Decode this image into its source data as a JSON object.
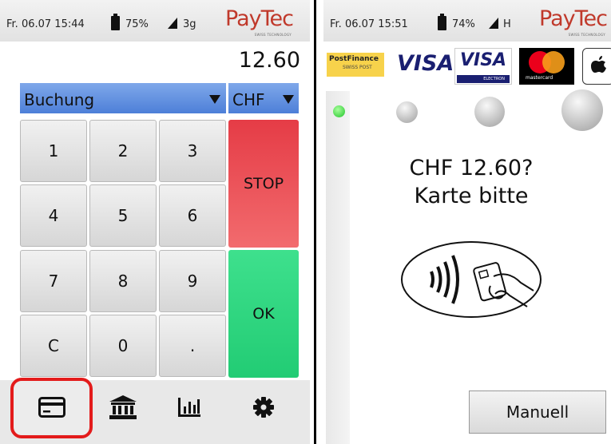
{
  "left": {
    "status": {
      "datetime": "Fr. 06.07 15:44",
      "battery": "75%",
      "network": "3g"
    },
    "brand": {
      "logo": "PayTec",
      "tagline": "SWISS TECHNOLOGY"
    },
    "amount": "12.60",
    "mode_select": {
      "value": "Buchung"
    },
    "currency_select": {
      "value": "CHF"
    },
    "keypad": {
      "keys": [
        "1",
        "2",
        "3",
        "4",
        "5",
        "6",
        "7",
        "8",
        "9",
        "C",
        "0",
        "."
      ],
      "stop_label": "STOP",
      "ok_label": "OK"
    },
    "nav": [
      {
        "icon": "card-icon",
        "active": true
      },
      {
        "icon": "bank-icon",
        "active": false
      },
      {
        "icon": "bar-chart-icon",
        "active": false
      },
      {
        "icon": "gear-icon",
        "active": false
      }
    ],
    "highlight_color": "#e31b1b"
  },
  "right": {
    "status": {
      "datetime": "Fr. 06.07 15:51",
      "battery": "74%",
      "network": "H"
    },
    "brand": {
      "logo": "PayTec",
      "tagline": "SWISS TECHNOLOGY"
    },
    "payment_brands": {
      "postfinance": "PostFinance",
      "postfinance_sub": "SWISS POST",
      "visa": "VISA",
      "visa_electron": "VISA",
      "visa_electron_sub": "ELECTRON",
      "mastercard_sub": "mastercard",
      "apple_pay_icon": "apple-icon"
    },
    "prompt_line1": "CHF 12.60?",
    "prompt_line2": "Karte bitte",
    "manual_button": "Manuell"
  }
}
